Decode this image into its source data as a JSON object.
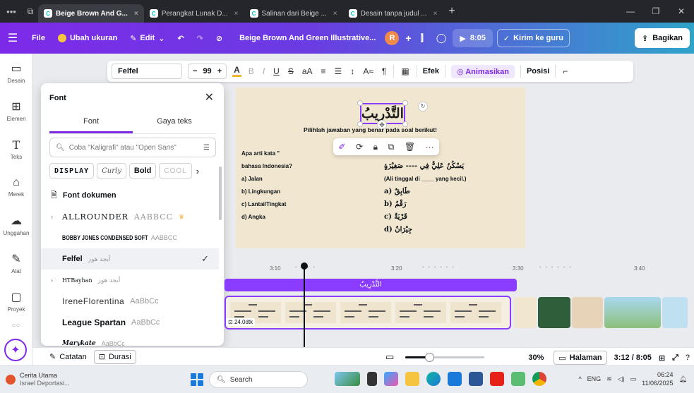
{
  "browser": {
    "tabs": [
      {
        "label": "Beige Brown And G...",
        "active": true
      },
      {
        "label": "Perangkat Lunak D...",
        "active": false
      },
      {
        "label": "Salinan dari Beige ...",
        "active": false
      },
      {
        "label": "Desain tanpa judul ...",
        "active": false
      }
    ]
  },
  "topbar": {
    "file": "File",
    "resize": "Ubah ukuran",
    "edit": "Edit",
    "doc_title": "Beige Brown And Green Illustrative...",
    "avatar": "R",
    "play_time": "8:05",
    "send": "Kirim ke guru",
    "share": "Bagikan"
  },
  "rail": {
    "items": [
      {
        "label": "Desain",
        "icon": "layout-icon"
      },
      {
        "label": "Elemen",
        "icon": "elements-icon"
      },
      {
        "label": "Teks",
        "icon": "text-icon"
      },
      {
        "label": "Merek",
        "icon": "brand-icon"
      },
      {
        "label": "Unggahan",
        "icon": "upload-icon"
      },
      {
        "label": "Alat",
        "icon": "draw-icon"
      },
      {
        "label": "Proyek",
        "icon": "folder-icon"
      }
    ]
  },
  "format": {
    "font": "Felfel",
    "size": "99",
    "effects": "Efek",
    "animate": "Animasikan",
    "position": "Posisi"
  },
  "fontpanel": {
    "title": "Font",
    "tab_font": "Font",
    "tab_styles": "Gaya teks",
    "search_placeholder": "Coba \"Kaligrafi\" atau \"Open Sans\"",
    "chips": [
      "DISPLAY",
      "Curly",
      "Bold",
      "COOL"
    ],
    "doc_fonts": "Font dokumen",
    "fonts": [
      {
        "name": "ALLROUNDER",
        "sample": "AABBCC",
        "expand": true
      },
      {
        "name": "BOBBY JONES CONDENSED SOFT",
        "sample": "AABBCC",
        "expand": false
      },
      {
        "name": "Felfel",
        "sample": "أبجد هوز",
        "expand": false,
        "selected": true
      },
      {
        "name": "HTBayhan",
        "sample": "أبجد هوز",
        "expand": true
      },
      {
        "name": "IreneFlorentina",
        "sample": "AaBbCc",
        "expand": false
      },
      {
        "name": "League Spartan",
        "sample": "AaBbCc",
        "expand": false
      },
      {
        "name": "Marykate",
        "sample": "AaBbCc",
        "expand": false
      }
    ]
  },
  "canvas": {
    "title": "التَّدْرِيبُ",
    "instruction": "Pilihlah jawaban yang benar pada soal berikut!",
    "q1_line1": "Apa arti kata \" ",
    "q1_line2": "bahasa Indonesia?",
    "q1_options": [
      "a) Jalan",
      "b) Lingkungan",
      "c) Lantai/Tingkat",
      "d) Angka"
    ],
    "q2_line1": "...mat berikut:",
    "q2_arabic": "يَسْكُنُ عَلِيٌّ فِي ---- صَغِيْرَةٍ",
    "q2_translation": "(Ali tinggal di ____ yang kecil.)",
    "q2_options": [
      "a) طَابِقٌ",
      "b) رَقْمٌ",
      "c) قَرْيَةٌ",
      "d) جِيْرَانٌ"
    ]
  },
  "timeline": {
    "ticks": [
      "3:10",
      "3:20",
      "3:30",
      "3:40"
    ],
    "text_track": "التَّدْرِيبُ",
    "clip_duration": "24.0dtk"
  },
  "bottombar": {
    "notes": "Catatan",
    "duration": "Durasi",
    "zoom": "30%",
    "zoom_fraction": 0.3,
    "pages": "Halaman",
    "time": "3:12 / 8:05"
  },
  "taskbar": {
    "news_title": "Cerita Utama",
    "news_sub": "Israel Deportasi...",
    "search": "Search",
    "lang": "ENG",
    "time": "06:24",
    "date": "11/06/2025"
  }
}
